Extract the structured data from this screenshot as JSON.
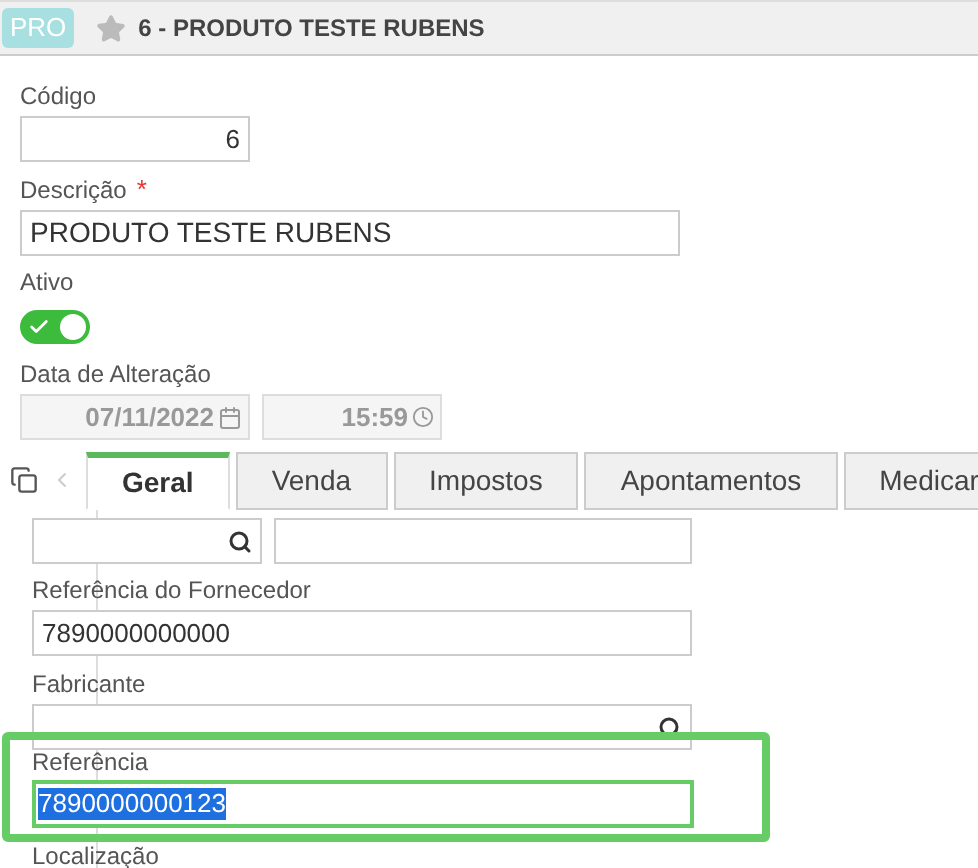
{
  "header": {
    "badge": "PRO",
    "starred": false,
    "title": "6 - PRODUTO TESTE RUBENS"
  },
  "codigo": {
    "label": "Código",
    "value": "6"
  },
  "descricao": {
    "label": "Descrição",
    "required_mark": "*",
    "value": "PRODUTO TESTE RUBENS"
  },
  "ativo": {
    "label": "Ativo",
    "on": true
  },
  "data_alteracao": {
    "label": "Data de Alteração",
    "date": "07/11/2022",
    "time": "15:59"
  },
  "tabs": [
    {
      "label": "Geral",
      "selected": true
    },
    {
      "label": "Venda",
      "selected": false
    },
    {
      "label": "Impostos",
      "selected": false
    },
    {
      "label": "Apontamentos",
      "selected": false
    },
    {
      "label": "Medicar",
      "selected": false
    }
  ],
  "geral": {
    "referencia_fornecedor": {
      "label": "Referência do Fornecedor",
      "value": "7890000000000"
    },
    "fabricante": {
      "label": "Fabricante"
    },
    "referencia": {
      "label": "Referência",
      "value": "7890000000123",
      "highlighted": true
    },
    "localizacao": {
      "label": "Localização"
    }
  }
}
